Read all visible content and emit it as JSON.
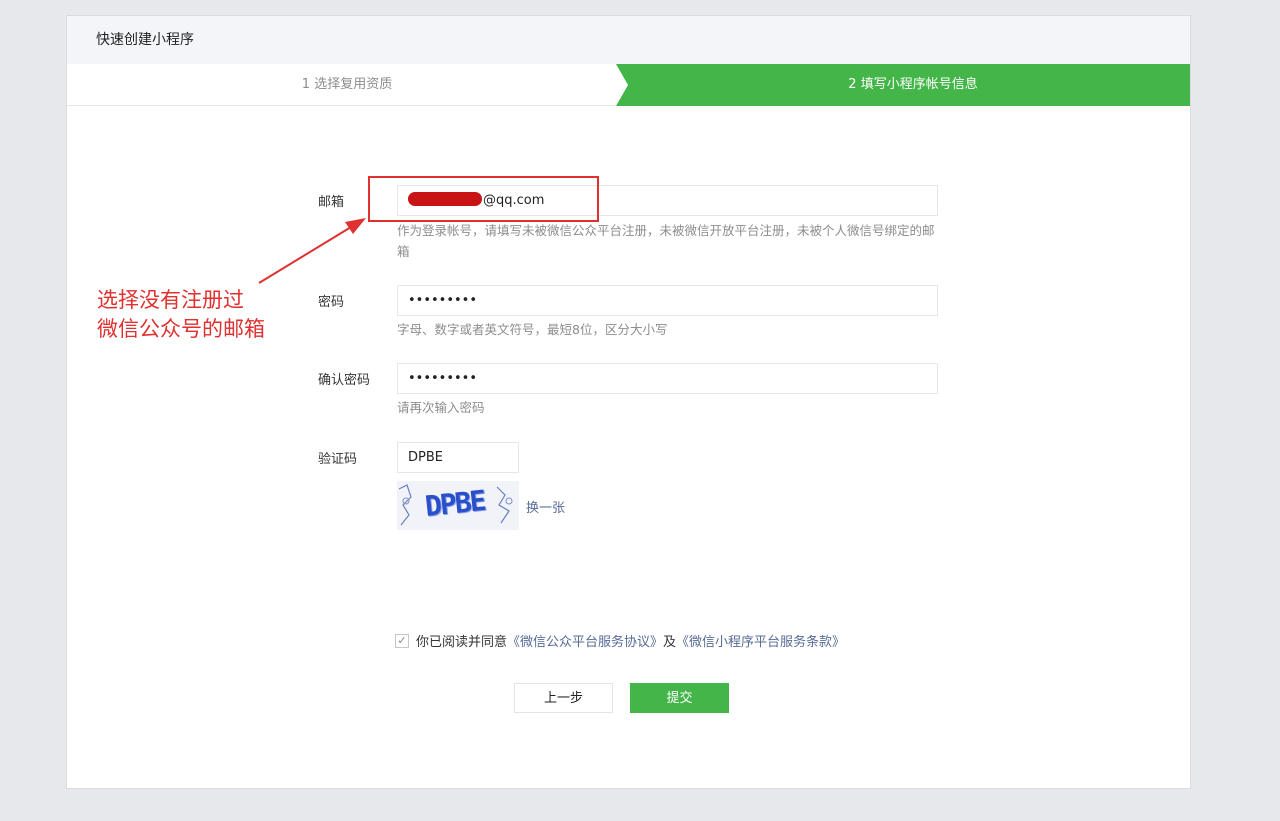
{
  "header": {
    "title": "快速创建小程序"
  },
  "steps": [
    {
      "label": "1 选择复用资质"
    },
    {
      "label": "2 填写小程序帐号信息"
    }
  ],
  "form": {
    "email": {
      "label": "邮箱",
      "value_suffix": "@qq.com",
      "hint": "作为登录帐号，请填写未被微信公众平台注册，未被微信开放平台注册，未被个人微信号绑定的邮箱"
    },
    "password": {
      "label": "密码",
      "value": "•••••••••",
      "hint": "字母、数字或者英文符号，最短8位，区分大小写"
    },
    "confirm_password": {
      "label": "确认密码",
      "value": "•••••••••",
      "hint": "请再次输入密码"
    },
    "captcha": {
      "label": "验证码",
      "value": "DPBE",
      "image_text": "DPBE",
      "refresh_label": "换一张"
    }
  },
  "agreement": {
    "checked": true,
    "prefix": "你已阅读并同意",
    "link1": "《微信公众平台服务协议》",
    "middle": "及",
    "link2": "《微信小程序平台服务条款》"
  },
  "buttons": {
    "prev": "上一步",
    "submit": "提交"
  },
  "annotation": {
    "line1": "选择没有注册过",
    "line2": "微信公众号的邮箱",
    "color": "#e0302f"
  },
  "colors": {
    "accent": "#44b549",
    "link": "#576b95"
  }
}
